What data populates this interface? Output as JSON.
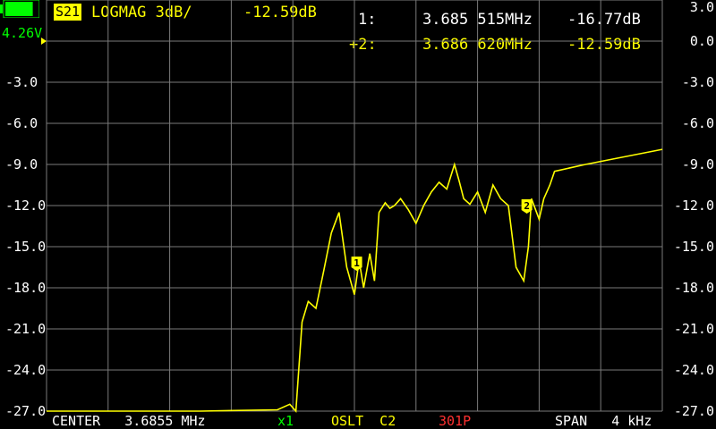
{
  "status": {
    "voltage": "4.26V",
    "battery_color": "#00ff00",
    "battery_level": 0.85
  },
  "trace": {
    "badge": "S21",
    "format": "LOGMAG 3dB/",
    "value": "-12.59dB",
    "color": "#ffff00"
  },
  "markers": [
    {
      "id": "1:",
      "freq": "3.685 515MHz",
      "value": "-16.77dB"
    },
    {
      "id": "+2:",
      "freq": "3.686 620MHz",
      "value": "-12.59dB"
    }
  ],
  "footer": {
    "center": "CENTER   3.6855 MHz",
    "zoom": "x1",
    "cal": "OSLT  C2",
    "points": "301P",
    "span": "SPAN   4 kHz"
  },
  "chart_data": {
    "type": "line",
    "xlabel": "",
    "ylabel": "",
    "xlim": [
      3.6835,
      3.6875
    ],
    "ylim": [
      -27.0,
      3.0
    ],
    "ytick_labels": [
      "3.0",
      "0.0",
      "-3.0",
      "-6.0",
      "-9.0",
      "-12.0",
      "-15.0",
      "-18.0",
      "-21.0",
      "-24.0",
      "-27.0"
    ],
    "x_units": "MHz",
    "reference_level": 0.0,
    "grid": true,
    "series": [
      {
        "color": "#ffff00",
        "x": [
          3.6835,
          3.684,
          3.6845,
          3.685,
          3.68508,
          3.68512,
          3.68516,
          3.6852,
          3.68525,
          3.6853,
          3.68535,
          3.6854,
          3.68545,
          3.6855,
          3.68553,
          3.68556,
          3.6856,
          3.68563,
          3.68566,
          3.6857,
          3.68573,
          3.68576,
          3.6858,
          3.68585,
          3.6859,
          3.68595,
          3.686,
          3.68605,
          3.6861,
          3.68615,
          3.68618,
          3.68621,
          3.68625,
          3.6863,
          3.68635,
          3.6864,
          3.68645,
          3.6865,
          3.68655,
          3.6866,
          3.68663,
          3.68665,
          3.6867,
          3.68673,
          3.68675,
          3.68677,
          3.6868,
          3.687,
          3.6875
        ],
        "y": [
          -27.0,
          -27.0,
          -27.0,
          -26.9,
          -26.5,
          -27.0,
          -20.5,
          -19.0,
          -19.5,
          -16.8,
          -14.0,
          -12.5,
          -16.5,
          -18.5,
          -16.0,
          -18.0,
          -15.5,
          -17.5,
          -12.5,
          -11.8,
          -12.2,
          -12.0,
          -11.5,
          -12.3,
          -13.3,
          -12.0,
          -11.0,
          -10.3,
          -10.8,
          -9.0,
          -10.2,
          -11.5,
          -11.9,
          -11.0,
          -12.5,
          -10.5,
          -11.5,
          -12.0,
          -16.5,
          -17.5,
          -15.0,
          -11.5,
          -13.0,
          -11.5,
          -11.0,
          -10.5,
          -9.5,
          -9.0,
          -7.9
        ]
      }
    ],
    "markers": [
      {
        "label": "1",
        "x": 3.685515,
        "y": -16.77
      },
      {
        "label": "2",
        "x": 3.68662,
        "y": -12.59
      }
    ]
  }
}
